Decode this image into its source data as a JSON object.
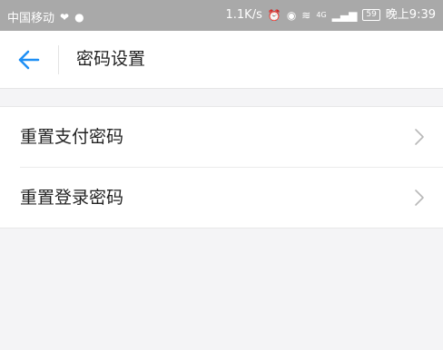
{
  "status_bar": {
    "carrier": "中国移动",
    "speed": "1.1K/s",
    "network": "4G",
    "battery": "59",
    "time": "晚上9:39"
  },
  "nav": {
    "title": "密码设置"
  },
  "list": {
    "items": [
      {
        "label": "重置支付密码"
      },
      {
        "label": "重置登录密码"
      }
    ]
  },
  "colors": {
    "accent": "#1e8ff5",
    "background": "#f4f4f6",
    "status_bar": "#a9a9a9",
    "chevron": "#b8b8b8"
  }
}
